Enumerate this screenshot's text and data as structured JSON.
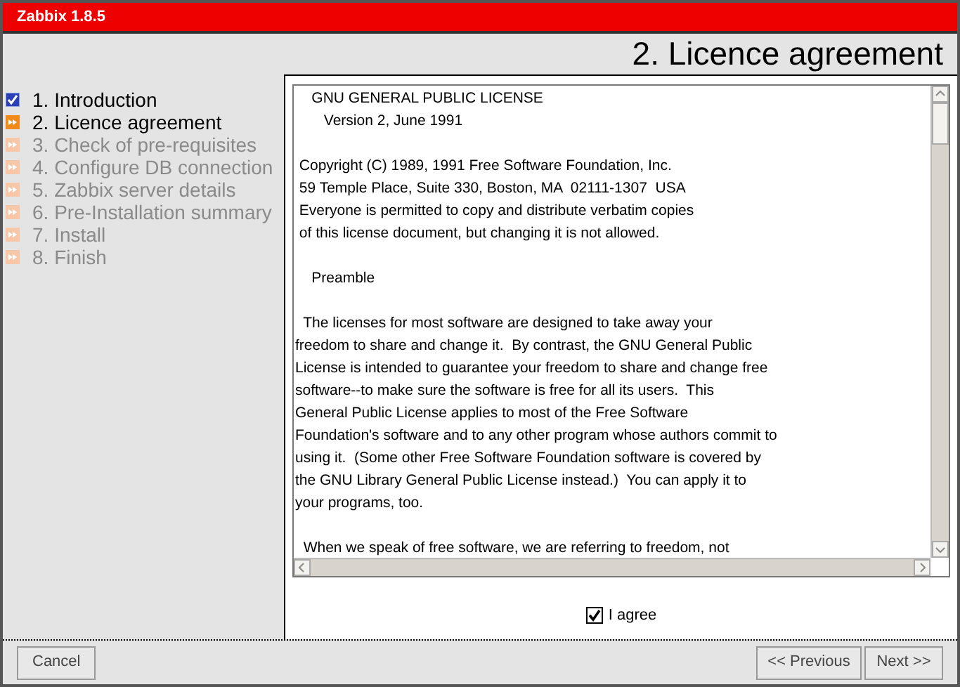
{
  "app_title": "Zabbix 1.8.5",
  "page_title": "2. Licence agreement",
  "steps": [
    {
      "label": "1. Introduction",
      "completed": true,
      "selected": false
    },
    {
      "label": "2. Licence agreement",
      "completed": false,
      "selected": true
    },
    {
      "label": "3. Check of pre-requisites",
      "completed": false,
      "selected": false
    },
    {
      "label": "4. Configure DB connection",
      "completed": false,
      "selected": false
    },
    {
      "label": "5. Zabbix server details",
      "completed": false,
      "selected": false
    },
    {
      "label": "6. Pre-Installation summary",
      "completed": false,
      "selected": false
    },
    {
      "label": "7. Install",
      "completed": false,
      "selected": false
    },
    {
      "label": "8. Finish",
      "completed": false,
      "selected": false
    }
  ],
  "license_paragraphs": [
    [
      "    GNU GENERAL PUBLIC LICENSE",
      "       Version 2, June 1991"
    ],
    [
      " Copyright (C) 1989, 1991 Free Software Foundation, Inc.",
      " 59 Temple Place, Suite 330, Boston, MA  02111-1307  USA",
      " Everyone is permitted to copy and distribute verbatim copies",
      " of this license document, but changing it is not allowed."
    ],
    [
      "    Preamble"
    ],
    [
      "  The licenses for most software are designed to take away your",
      "freedom to share and change it.  By contrast, the GNU General Public",
      "License is intended to guarantee your freedom to share and change free",
      "software--to make sure the software is free for all its users.  This",
      "General Public License applies to most of the Free Software",
      "Foundation's software and to any other program whose authors commit to",
      "using it.  (Some other Free Software Foundation software is covered by",
      "the GNU Library General Public License instead.)  You can apply it to",
      "your programs, too."
    ],
    [
      "  When we speak of free software, we are referring to freedom, not"
    ]
  ],
  "agree": {
    "label": "I agree",
    "checked": true
  },
  "buttons": {
    "cancel": "Cancel",
    "previous": "<< Previous",
    "next": "Next >>"
  }
}
